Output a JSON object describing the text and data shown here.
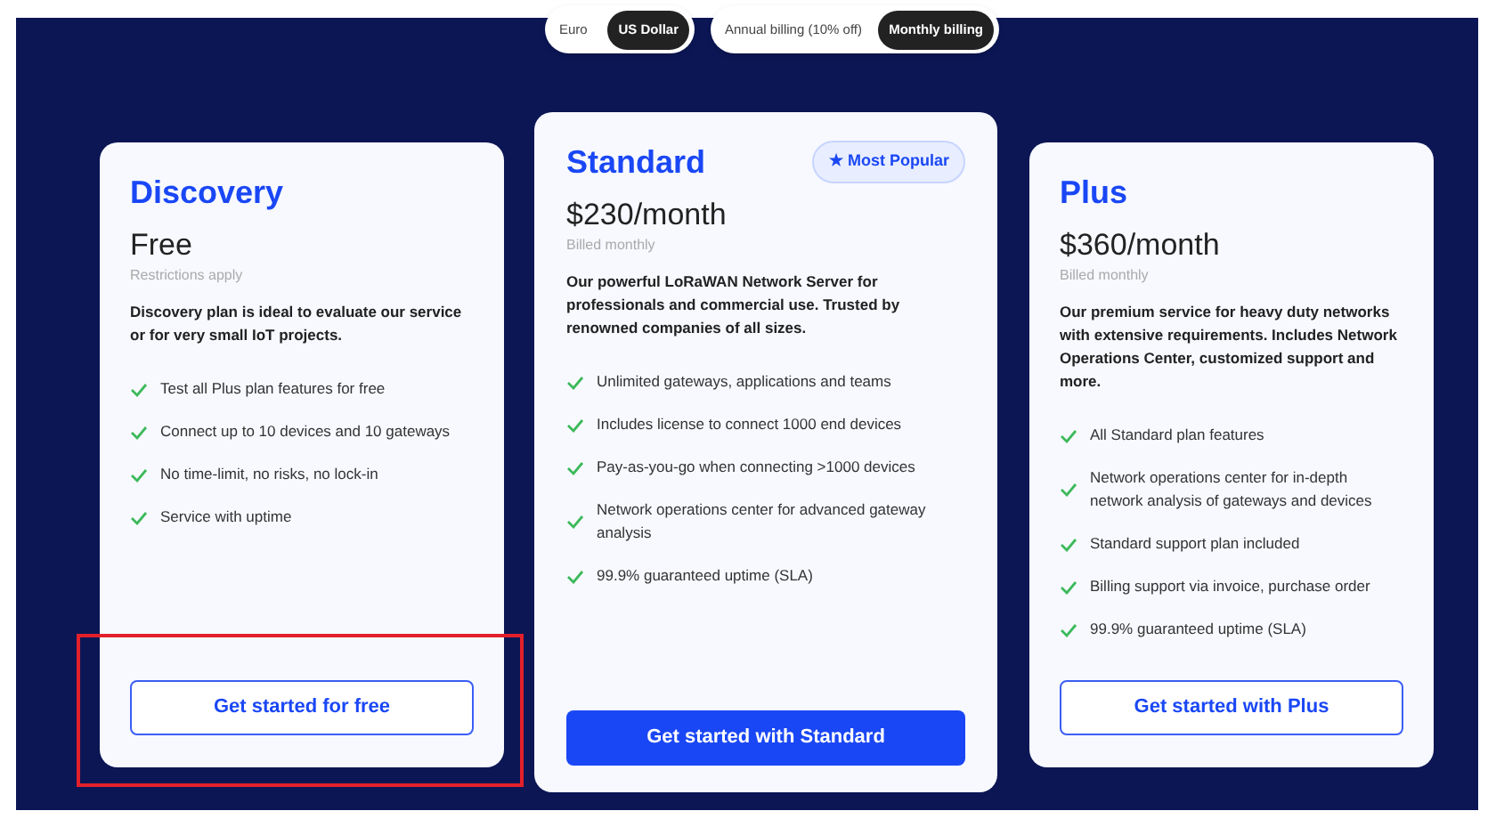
{
  "currency_toggle": [
    {
      "label": "Euro",
      "selected": false
    },
    {
      "label": "US Dollar",
      "selected": true
    }
  ],
  "billing_toggle": [
    {
      "label": "Annual billing (10% off)",
      "selected": false
    },
    {
      "label": "Monthly billing",
      "selected": true
    }
  ],
  "plans": [
    {
      "name": "Discovery",
      "featured": false,
      "price": "Free",
      "note": "Restrictions apply",
      "description": "Discovery plan is ideal to evaluate our service or for very small IoT projects.",
      "features": [
        {
          "text": "Test all Plus plan features for free"
        },
        {
          "text": "Connect up to 10 devices and 10 gateways"
        },
        {
          "text": "No time-limit, no risks, no lock-in"
        },
        {
          "text": "Service with uptime"
        }
      ],
      "button": "Get started for free",
      "highlighted": true
    },
    {
      "name": "Standard",
      "featured": true,
      "badge": "★ Most Popular",
      "price": "$230/month",
      "note": "Billed monthly",
      "description": "Our powerful LoRaWAN Network Server for professionals and commercial use. Trusted by renowned companies of all sizes.",
      "features": [
        {
          "text": "Unlimited gateways, applications and teams"
        },
        {
          "text": "Includes license to connect 1000 end devices"
        },
        {
          "text": "Pay-as-you-go when connecting >1000 devices"
        },
        {
          "text": "Network operations center for advanced gateway analysis"
        },
        {
          "text": "99.9% guaranteed uptime (SLA)"
        }
      ],
      "button": "Get started with Standard",
      "highlighted": false
    },
    {
      "name": "Plus",
      "featured": false,
      "price": "$360/month",
      "note": "Billed monthly",
      "description": "Our premium service for heavy duty networks with extensive requirements. Includes Network Operations Center, customized support and more.",
      "features": [
        {
          "text": "All Standard plan features"
        },
        {
          "text": "Network operations center for in-depth network analysis of gateways and devices"
        },
        {
          "text": "Standard support plan included"
        },
        {
          "text": "Billing support via invoice, purchase order"
        },
        {
          "text": "99.9% guaranteed uptime (SLA)"
        }
      ],
      "button": "Get started with Plus",
      "highlighted": false
    }
  ]
}
